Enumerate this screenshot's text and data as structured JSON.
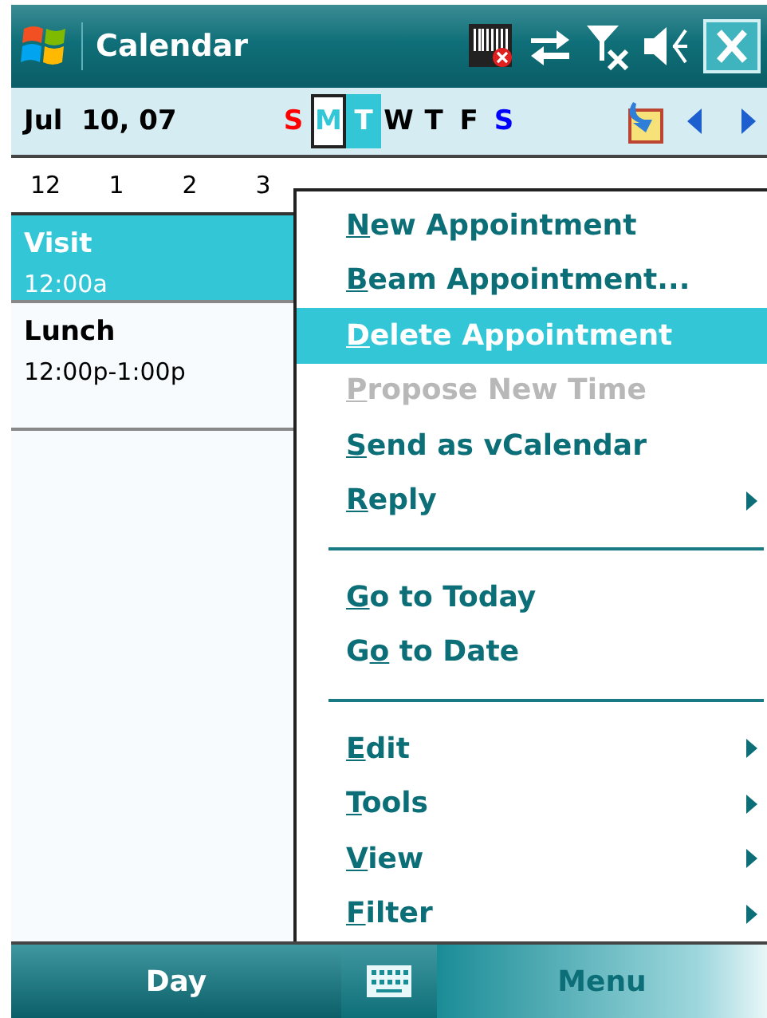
{
  "title_bar": {
    "title": "Calendar"
  },
  "date_bar": {
    "date": "Jul  10, 07",
    "days": [
      {
        "letter": "S",
        "color": "#ff0000",
        "today": false,
        "selected": false
      },
      {
        "letter": "M",
        "color": "#33c6d6",
        "today": true,
        "selected": false
      },
      {
        "letter": "T",
        "color": "#ffffff",
        "today": false,
        "selected": true
      },
      {
        "letter": "W",
        "color": "#000000",
        "today": false,
        "selected": false
      },
      {
        "letter": "T",
        "color": "#000000",
        "today": false,
        "selected": false
      },
      {
        "letter": "F",
        "color": "#000000",
        "today": false,
        "selected": false
      },
      {
        "letter": "S",
        "color": "#0000ff",
        "today": false,
        "selected": false
      }
    ]
  },
  "hours": [
    "12",
    "1",
    "2",
    "3"
  ],
  "appointments": [
    {
      "title": "Visit",
      "time": "12:00a",
      "selected": true
    },
    {
      "title": "Lunch",
      "time": "12:00p-1:00p",
      "selected": false
    }
  ],
  "menu": [
    {
      "kind": "item",
      "key": "N",
      "post": "ew Appointment",
      "selected": false,
      "disabled": false,
      "submenu": false
    },
    {
      "kind": "item",
      "key": "B",
      "post": "eam Appointment...",
      "selected": false,
      "disabled": false,
      "submenu": false
    },
    {
      "kind": "item",
      "key": "D",
      "post": "elete Appointment",
      "selected": true,
      "disabled": false,
      "submenu": false
    },
    {
      "kind": "item",
      "key": "P",
      "post": "ropose New Time",
      "selected": false,
      "disabled": true,
      "submenu": false
    },
    {
      "kind": "item",
      "key": "S",
      "post": "end as vCalendar",
      "selected": false,
      "disabled": false,
      "submenu": false
    },
    {
      "kind": "item",
      "key": "R",
      "post": "eply",
      "selected": false,
      "disabled": false,
      "submenu": true
    },
    {
      "kind": "separator"
    },
    {
      "kind": "item",
      "key": "G",
      "post": "o to Today",
      "selected": false,
      "disabled": false,
      "submenu": false
    },
    {
      "kind": "item",
      "pre": "G",
      "key": "o",
      "post": " to Date",
      "selected": false,
      "disabled": false,
      "submenu": false
    },
    {
      "kind": "separator"
    },
    {
      "kind": "item",
      "key": "E",
      "post": "dit",
      "selected": false,
      "disabled": false,
      "submenu": true
    },
    {
      "kind": "item",
      "key": "T",
      "post": "ools",
      "selected": false,
      "disabled": false,
      "submenu": true
    },
    {
      "kind": "item",
      "key": "V",
      "post": "iew",
      "selected": false,
      "disabled": false,
      "submenu": true
    },
    {
      "kind": "item",
      "key": "F",
      "post": "ilter",
      "selected": false,
      "disabled": false,
      "submenu": true
    }
  ],
  "soft_keys": {
    "left": "Day",
    "right": "Menu",
    "right_pressed": true
  }
}
